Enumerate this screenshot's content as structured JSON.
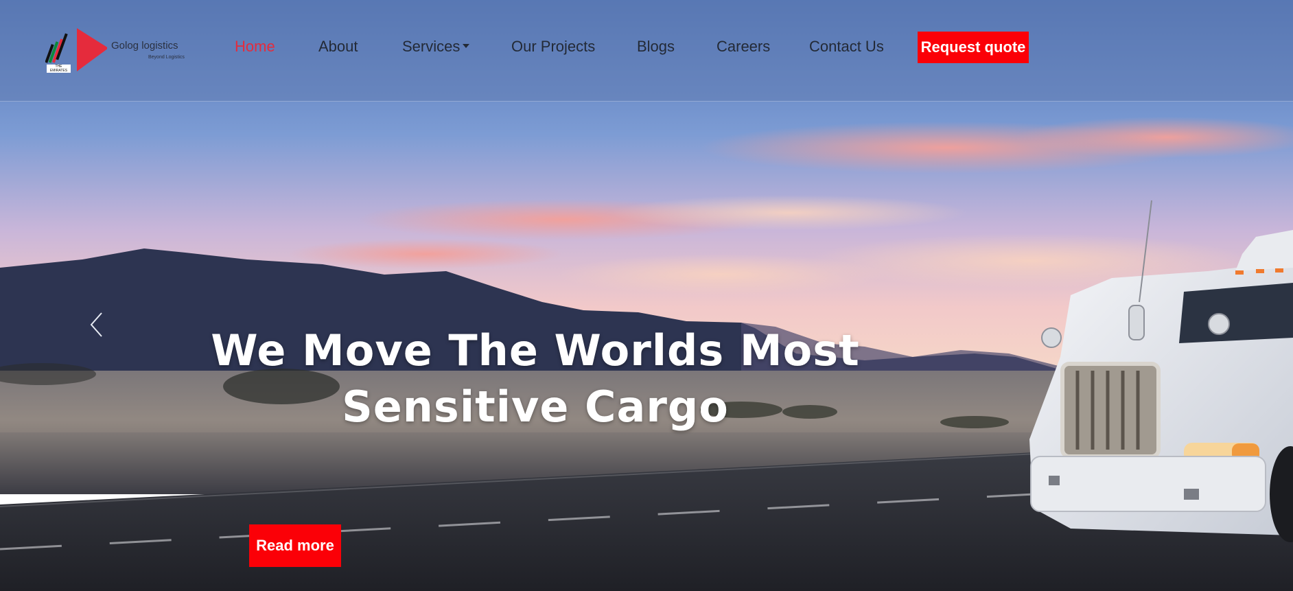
{
  "brand": {
    "name": "Golog logistics",
    "tagline": "Beyond Logistics",
    "badge": "THE EMIRATES",
    "accent_color": "#fb0007"
  },
  "nav": {
    "items": [
      {
        "label": "Home",
        "active": true
      },
      {
        "label": "About"
      },
      {
        "label": "Services",
        "has_dropdown": true
      },
      {
        "label": "Our Projects"
      },
      {
        "label": "Blogs"
      },
      {
        "label": "Careers"
      },
      {
        "label": "Contact Us"
      }
    ],
    "cta_label": "Request quote"
  },
  "hero": {
    "title_line1": "We Move The Worlds Most",
    "title_line2": "Sensitive Cargo",
    "button_label": "Read more",
    "prev_icon": "chevron-left-icon"
  }
}
